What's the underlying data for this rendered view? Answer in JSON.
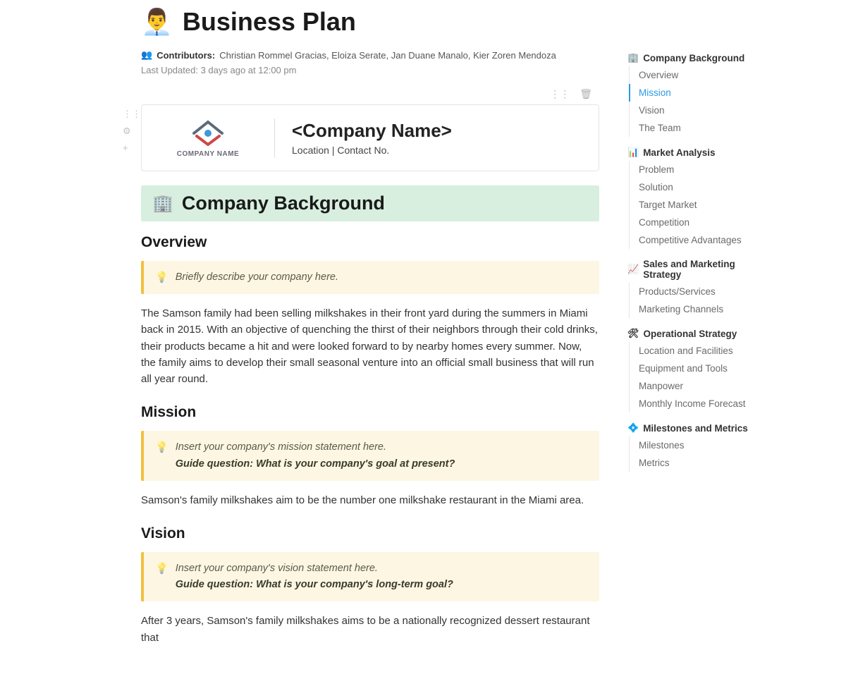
{
  "page": {
    "icon": "👨‍💼",
    "title": "Business Plan",
    "contributors_label": "Contributors",
    "contributors": "Christian Rommel Gracias, Eloiza Serate, Jan Duane Manalo, Kier Zoren Mendoza",
    "updated_label": "Last Updated:",
    "updated_value": "3 days ago at 12:00 pm"
  },
  "company_card": {
    "logo_caption": "COMPANY NAME",
    "name": "<Company Name>",
    "sub": "Location | Contact No."
  },
  "banner": {
    "icon": "🏢",
    "title": "Company Background"
  },
  "overview": {
    "heading": "Overview",
    "callout": "Briefly describe your company here.",
    "body": "The Samson family had been selling milkshakes in their front yard during the summers in Miami back in 2015. With an objective of quenching the thirst of their neighbors through their cold drinks, their products became a hit and were looked forward to by nearby homes every summer. Now, the family aims to develop their small seasonal venture into an official small business that will run all year round."
  },
  "mission": {
    "heading": "Mission",
    "callout_line1": "Insert your company's mission statement here.",
    "callout_guide": "Guide question: What is your company's goal at present?",
    "body": "Samson's family milkshakes aim to be the number one milkshake restaurant in the Miami area."
  },
  "vision": {
    "heading": "Vision",
    "callout_line1": "Insert your company's vision statement here.",
    "callout_guide": "Guide question: What is your company's long-term goal?",
    "body": "After 3 years, Samson's family milkshakes aims to be a nationally recognized dessert restaurant that"
  },
  "toc": {
    "s1": {
      "icon": "🏢",
      "title": "Company Background",
      "items": [
        "Overview",
        "Mission",
        "Vision",
        "The Team"
      ],
      "active": 1
    },
    "s2": {
      "icon": "📊",
      "title": "Market Analysis",
      "items": [
        "Problem",
        "Solution",
        "Target Market",
        "Competition",
        "Competitive Advantages"
      ]
    },
    "s3": {
      "icon": "📈",
      "title": "Sales and Marketing Strategy",
      "items": [
        "Products/Services",
        "Marketing Channels"
      ]
    },
    "s4": {
      "icon": "🛠",
      "title": "Operational Strategy",
      "items": [
        "Location and Facilities",
        "Equipment and Tools",
        "Manpower",
        "Monthly Income Forecast"
      ]
    },
    "s5": {
      "icon": "💠",
      "title": "Milestones and Metrics",
      "items": [
        "Milestones",
        "Metrics"
      ]
    }
  }
}
